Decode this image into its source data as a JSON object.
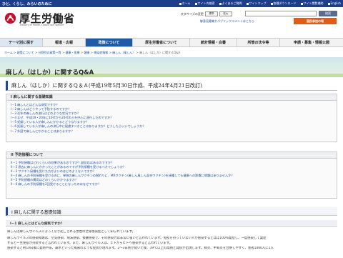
{
  "header": {
    "tagline": "ひと、くらし、みらいのために",
    "links": [
      "ホーム",
      "サイト内検索",
      "よくあるご質問",
      "サイトマップ",
      "各種ダウンロード",
      "サイト閲覧補助",
      "English"
    ],
    "brand": "厚生労働省",
    "brand_en": "Ministry of Health, Labour and Welfare",
    "font_size_label": "文字サイズの変更",
    "font_buttons": [
      "標準",
      "拡大"
    ],
    "search_placeholder": "",
    "search_button": "検索",
    "bookmark_text": "御意見募集やパブリックコメントはこちら",
    "kokumin_button": "国民参加の場"
  },
  "nav": {
    "items": [
      "テーマ別に探す",
      "報道・広報",
      "政策について",
      "厚生労働省について",
      "統計情報・白書",
      "所管の法令等",
      "申請・募集・情報公開"
    ],
    "active_index": 2
  },
  "breadcrumb": {
    "items": [
      "ホーム",
      "政策について",
      "分野別の政策一覧",
      "健康・医療",
      "健康",
      "感染症情報",
      "麻しん（風しん）",
      "麻しん（はしか）に関するQ&A"
    ],
    "separator": " > "
  },
  "page": {
    "title": "麻しん（はしか）に関するQ&A",
    "subtitle": "麻しん（はしか）に関するＱ＆Ａ(平成19年5月30日作成、平成24年4月21日改訂)"
  },
  "section1": {
    "heading": "I 麻しんに関する基礎知識",
    "items": [
      {
        "prefix": "I－1",
        "label": "麻しんとはどんな病気ですか？"
      },
      {
        "prefix": "I－2",
        "label": "麻しんはどうやって予防するのですか？"
      },
      {
        "prefix": "I－3",
        "label": "近年の麻しんの流行はどのような状況ですか？"
      },
      {
        "prefix": "I－4",
        "label": "なぜ、平成19・20年に10代から20代の人を中心に流行したのですか？"
      },
      {
        "prefix": "I－5",
        "label": "妊娠している人が麻しんにかかるとどうなりますか？"
      },
      {
        "prefix": "I－6",
        "label": "妊娠している人が麻しんの流行中に配慮すべきことはありますか？どうしたらいいでしょうか？"
      },
      {
        "prefix": "I－7",
        "label": "外国で麻しんにかかることはありますか？"
      }
    ]
  },
  "section2": {
    "heading": "II 予防接種について",
    "items": [
      {
        "prefix": "II－1",
        "label": "予防接種はどれくらいの効果があるのですか？副反応はあるのですか？"
      },
      {
        "prefix": "II－2",
        "label": "過去に麻しんにかかったことがあるのですが予防接種を受けるべきでしょうか？"
      },
      {
        "prefix": "II－3",
        "label": "ワクチン接種を受けた方がよいのはどのような人ですか？"
      },
      {
        "prefix": "II－4",
        "label": "麻しんの予防接種を受けるのに、単独の麻しんワクチンの替わりに、MRワクチン(麻しん風しん混合ワクチン)を接種しても健康への影響に問題はありませんか？"
      },
      {
        "prefix": "II－5",
        "label": "予防接種の費用はどのくらいかかりますか？"
      },
      {
        "prefix": "II－6",
        "label": "麻しんの予防接種を2回受けることになったのはなぜですか？"
      }
    ]
  },
  "content": {
    "section_heading": "I 麻しんに関する基礎知識",
    "question": "I－1 麻しんとはどんな病気ですか？",
    "answer_lines": [
      "麻しんは麻しんウイルスによって引き起こされる急性の全身感染症として知られています。",
      "麻しんウイルスの感染経路は、空気感染、飛沫感染、接触感染で、その感染力は非常に強いと言われています。免疫を持っていない人が感染するとほぼ100%発症し、一度感染して発症",
      "すると一生免疫が持続すると言われています。また、麻しんウイルスは、ヒトからヒトへ感染すると言われています。",
      "感染すると約10日後に発熱や咳、鼻水といった風邪のような症状が現れます。2～3日熱が続いた後、39℃以上の高熱と発疹が出現します。肺炎、中耳炎を合併しやすく、患者1000人に1人"
    ]
  }
}
